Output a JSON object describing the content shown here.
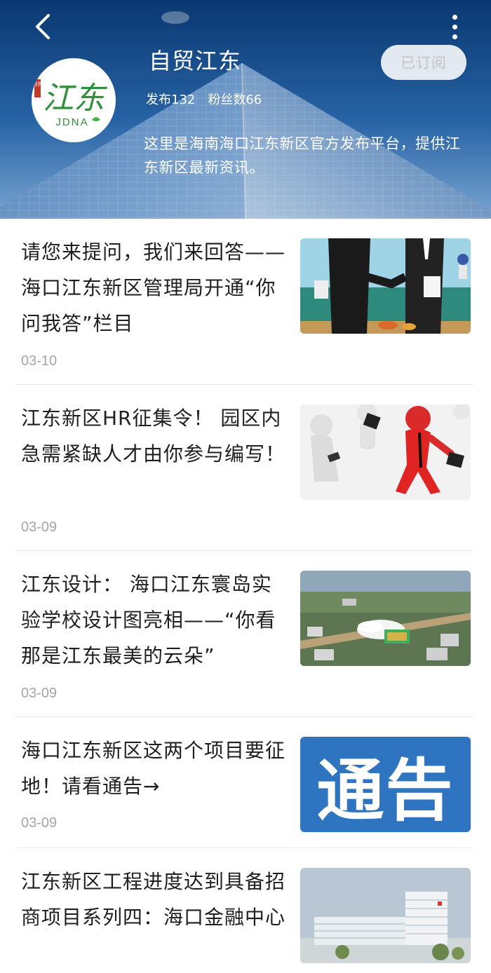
{
  "header": {
    "title": "自贸江东",
    "stats": {
      "posts": "发布132",
      "fans": "粉丝数66"
    },
    "subscribe_label": "已订阅",
    "description": "这里是海南海口江东新区官方发布平台，提供江东新区最新资讯。",
    "logo": {
      "chinese": "江东",
      "latin": "JDNA",
      "seal": "自贸"
    }
  },
  "articles": [
    {
      "title": "请您来提问，我们来回答——海口江东新区管理局开通“你问我答”栏目",
      "date": "03-10",
      "thumb": "handshake-illustration"
    },
    {
      "title": "江东新区HR征集令！ 园区内急需紧缺人才由你参与编写！",
      "date": "03-09",
      "thumb": "running-figures-illustration"
    },
    {
      "title": "江东设计： 海口江东寰岛实验学校设计图亮相——“你看 那是江东最美的云朵”",
      "date": "03-09",
      "thumb": "school-aerial-render"
    },
    {
      "title": "海口江东新区这两个项目要征地！请看通告→",
      "date": "03-09",
      "thumb": "notice-banner",
      "thumb_text": "通告"
    },
    {
      "title": "江东新区工程进度达到具备招商项目系列四：海口金融中心",
      "date": "",
      "thumb": "building-render"
    }
  ],
  "colors": {
    "header_blue": "#1f5ea6",
    "notice_blue": "#2f74c0",
    "date_gray": "#a5a5a5",
    "logo_green": "#3a9a3a"
  }
}
